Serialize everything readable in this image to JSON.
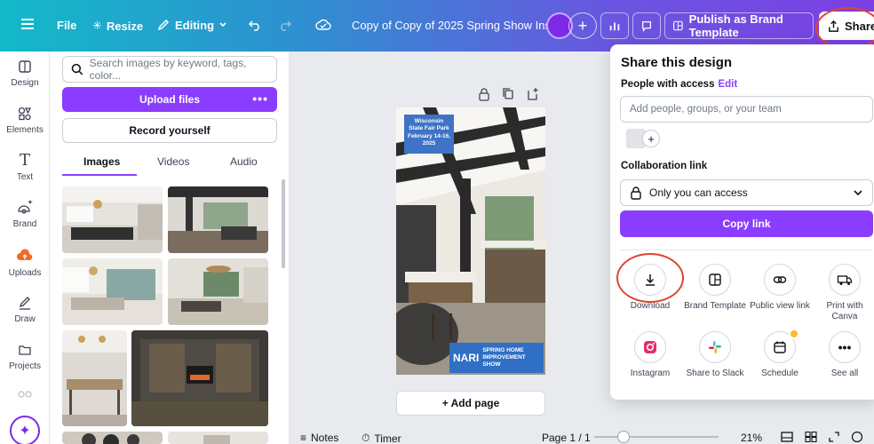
{
  "topbar": {
    "file_label": "File",
    "resize_label": "Resize",
    "editing_label": "Editing",
    "document_title": "Copy of Copy of 2025 Spring Show Ins...",
    "publish_label": "Publish as Brand Template",
    "share_label": "Share"
  },
  "rail": {
    "items": [
      {
        "label": "Design"
      },
      {
        "label": "Elements"
      },
      {
        "label": "Text"
      },
      {
        "label": "Brand"
      },
      {
        "label": "Uploads"
      },
      {
        "label": "Draw"
      },
      {
        "label": "Projects"
      }
    ]
  },
  "panel": {
    "search_placeholder": "Search images by keyword, tags, color...",
    "upload_label": "Upload files",
    "upload_more": "•••",
    "record_label": "Record yourself",
    "tabs": [
      {
        "label": "Images"
      },
      {
        "label": "Videos"
      },
      {
        "label": "Audio"
      }
    ]
  },
  "design": {
    "badge_lines": [
      "Wisconsin",
      "State Fair Park",
      "February 14-16,",
      "2025"
    ],
    "logo_text": "NARI",
    "logo_lines": [
      "SPRING HOME",
      "IMPROVEMENT",
      "SHOW"
    ]
  },
  "canvas": {
    "add_page_label": "+ Add page"
  },
  "bottombar": {
    "notes_label": "Notes",
    "timer_label": "Timer",
    "page_indicator": "Page 1 / 1",
    "zoom": "21%"
  },
  "share_popup": {
    "title": "Share this design",
    "people_label": "People with access",
    "edit_label": "Edit",
    "people_placeholder": "Add people, groups, or your team",
    "collab_label": "Collaboration link",
    "access_value": "Only you can access",
    "copy_link_label": "Copy link",
    "options": [
      {
        "label": "Download"
      },
      {
        "label": "Brand Template"
      },
      {
        "label": "Public view link"
      },
      {
        "label": "Print with Canva"
      },
      {
        "label": "Instagram"
      },
      {
        "label": "Share to Slack"
      },
      {
        "label": "Schedule"
      },
      {
        "label": "See all"
      }
    ]
  },
  "colors": {
    "accent": "#8b3dff",
    "highlight_ring": "#e0442f"
  }
}
